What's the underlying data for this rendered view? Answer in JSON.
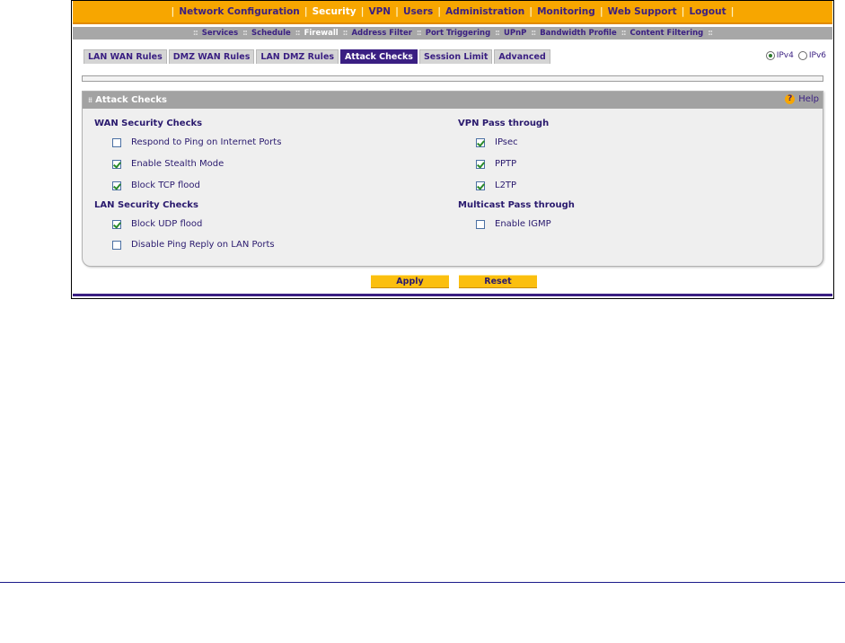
{
  "nav": {
    "items": [
      {
        "label": "Network Configuration",
        "active": false
      },
      {
        "label": "Security",
        "active": true
      },
      {
        "label": "VPN",
        "active": false
      },
      {
        "label": "Users",
        "active": false
      },
      {
        "label": "Administration",
        "active": false
      },
      {
        "label": "Monitoring",
        "active": false
      },
      {
        "label": "Web Support",
        "active": false
      },
      {
        "label": "Logout",
        "active": false
      }
    ],
    "separator": "|"
  },
  "subnav": {
    "items": [
      {
        "label": "Services",
        "active": false
      },
      {
        "label": "Schedule",
        "active": false
      },
      {
        "label": "Firewall",
        "active": true
      },
      {
        "label": "Address Filter",
        "active": false
      },
      {
        "label": "Port Triggering",
        "active": false
      },
      {
        "label": "UPnP",
        "active": false
      },
      {
        "label": "Bandwidth Profile",
        "active": false
      },
      {
        "label": "Content Filtering",
        "active": false
      }
    ],
    "separator": "::"
  },
  "tabs": [
    {
      "label": "LAN WAN Rules",
      "active": false
    },
    {
      "label": "DMZ WAN Rules",
      "active": false
    },
    {
      "label": "LAN DMZ Rules",
      "active": false
    },
    {
      "label": "Attack Checks",
      "active": true
    },
    {
      "label": "Session Limit",
      "active": false
    },
    {
      "label": "Advanced",
      "active": false
    }
  ],
  "ip_version": {
    "ipv4_label": "IPv4",
    "ipv6_label": "IPv6",
    "selected": "IPv4"
  },
  "panel": {
    "title": "Attack Checks",
    "help_label": "Help",
    "help_icon": "?"
  },
  "sections": {
    "wan": {
      "title": "WAN Security Checks",
      "options": [
        {
          "label": "Respond to Ping on Internet Ports",
          "checked": false
        },
        {
          "label": "Enable Stealth Mode",
          "checked": true
        },
        {
          "label": "Block TCP flood",
          "checked": true
        }
      ]
    },
    "lan": {
      "title": "LAN Security Checks",
      "options": [
        {
          "label": "Block UDP flood",
          "checked": true
        },
        {
          "label": "Disable Ping Reply on LAN Ports",
          "checked": false
        }
      ]
    },
    "vpn": {
      "title": "VPN Pass through",
      "options": [
        {
          "label": "IPsec",
          "checked": true
        },
        {
          "label": "PPTP",
          "checked": true
        },
        {
          "label": "L2TP",
          "checked": true
        }
      ]
    },
    "multicast": {
      "title": "Multicast Pass through",
      "options": [
        {
          "label": "Enable IGMP",
          "checked": false
        }
      ]
    }
  },
  "buttons": {
    "apply": "Apply",
    "reset": "Reset"
  },
  "colors": {
    "nav_bg": "#f7a600",
    "accent": "#3a1f82",
    "button": "#fbbf0f",
    "subnav_bg": "#a7a7a7"
  }
}
